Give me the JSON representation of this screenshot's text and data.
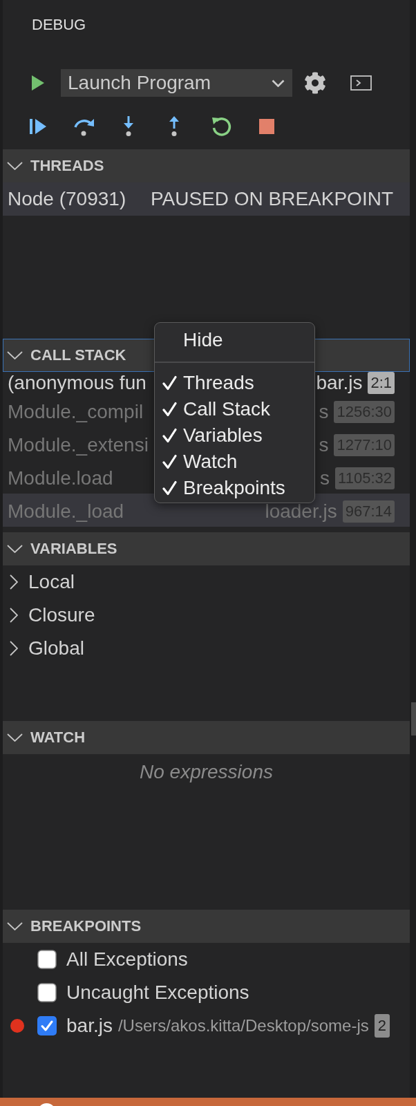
{
  "title": "DEBUG",
  "launch_config": {
    "value": "Launch Program"
  },
  "threads": {
    "header": "THREADS",
    "expanded": true,
    "items": [
      {
        "name": "Node (70931)",
        "state": "PAUSED ON BREAKPOINT",
        "selected": true
      }
    ]
  },
  "call_stack": {
    "header": "CALL STACK",
    "expanded": true,
    "focused": true,
    "frames": [
      {
        "name": "(anonymous fun",
        "file": "bar.js",
        "position": "2:1",
        "dimmed": false,
        "selected": false
      },
      {
        "name": "Module._compil",
        "file": "s",
        "position": "1256:30",
        "dimmed": true,
        "selected": false
      },
      {
        "name": "Module._extensi",
        "file": "s",
        "position": "1277:10",
        "dimmed": true,
        "selected": false
      },
      {
        "name": "Module.load",
        "file": "s",
        "position": "1105:32",
        "dimmed": true,
        "selected": false
      },
      {
        "name": "Module._load",
        "file": "loader.js",
        "position": "967:14",
        "dimmed": true,
        "selected": true
      }
    ]
  },
  "variables": {
    "header": "VARIABLES",
    "expanded": true,
    "scopes": [
      {
        "label": "Local",
        "expanded": false
      },
      {
        "label": "Closure",
        "expanded": false
      },
      {
        "label": "Global",
        "expanded": false
      }
    ]
  },
  "watch": {
    "header": "WATCH",
    "expanded": true,
    "empty_message": "No expressions"
  },
  "breakpoints": {
    "header": "BREAKPOINTS",
    "expanded": true,
    "items": [
      {
        "kind": "exception",
        "label": "All Exceptions",
        "checked": false
      },
      {
        "kind": "exception",
        "label": "Uncaught Exceptions",
        "checked": false
      },
      {
        "kind": "file",
        "label": "bar.js",
        "path": "/Users/akos.kitta/Desktop/some-js",
        "line": "2",
        "checked": true
      }
    ]
  },
  "context_menu": {
    "groups": [
      [
        {
          "label": "Hide",
          "checked": false
        }
      ],
      [
        {
          "label": "Threads",
          "checked": true
        },
        {
          "label": "Call Stack",
          "checked": true
        },
        {
          "label": "Variables",
          "checked": true
        },
        {
          "label": "Watch",
          "checked": true
        },
        {
          "label": "Breakpoints",
          "checked": true
        }
      ]
    ]
  }
}
